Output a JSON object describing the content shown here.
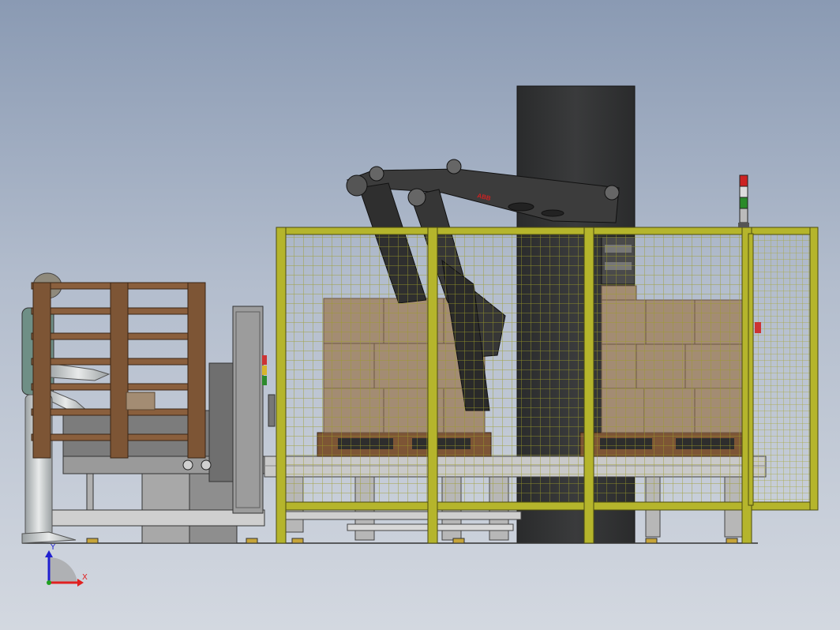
{
  "robot": {
    "brand": "ABB"
  },
  "triad": {
    "x_label": "X",
    "y_label": "Y"
  },
  "colors": {
    "background_top": "#8a9ab3",
    "background_bottom": "#d3d8e0",
    "fence_frame": "#b5b52c",
    "fence_mesh": "#9c9c2a",
    "carton": "#a38c73",
    "pallet_wood": "#8a5f3d",
    "robot_body": "#3c3c3c",
    "column": "#2e2f30",
    "conveyor": "#c9c9c9",
    "axis_x": "#e02020",
    "axis_y": "#2020d0",
    "axis_z": "#20a020"
  },
  "icons": {
    "stack_light": "stack-light-icon",
    "coordinate_triad": "coordinate-triad-icon",
    "emergency_stop": "emergency-stop-icon"
  }
}
